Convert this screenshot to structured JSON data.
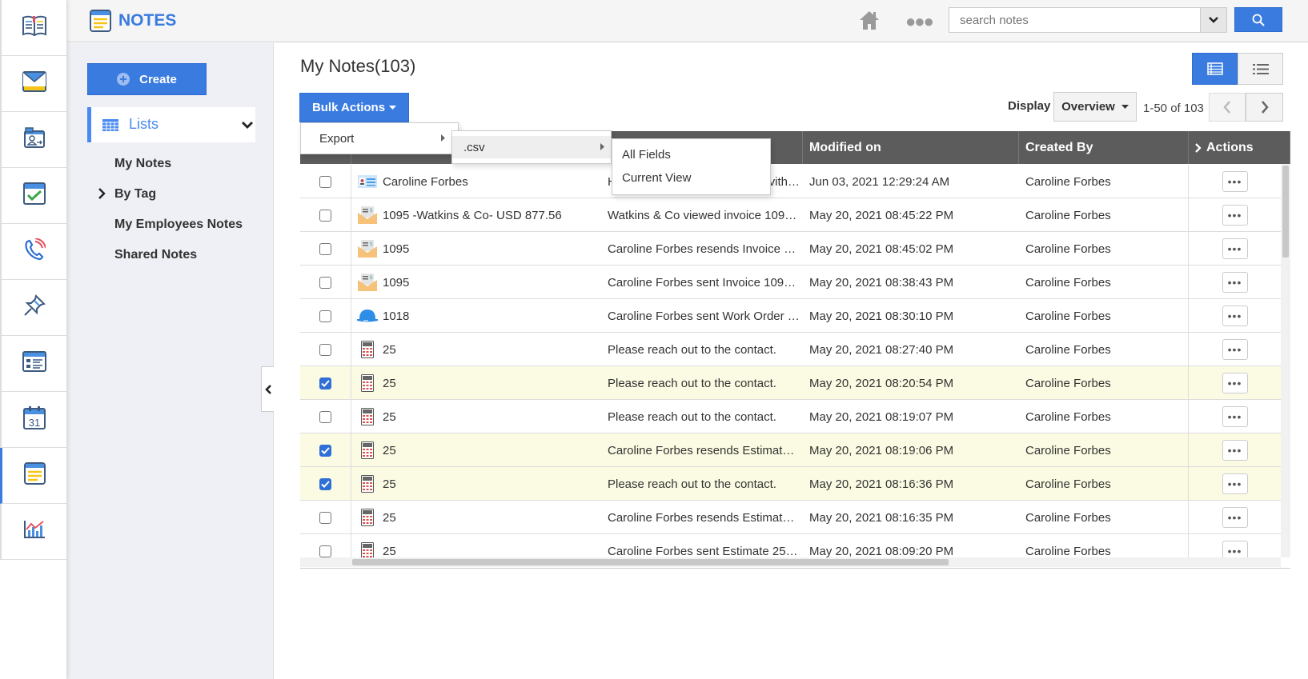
{
  "app": {
    "title": "NOTES",
    "accent": "#3a7be0"
  },
  "nav_icons": [
    "knowledge-base-icon",
    "mail-icon",
    "contacts-folder-icon",
    "tasks-calendar-icon",
    "phone-icon",
    "pin-icon",
    "forms-icon",
    "calendar-icon",
    "notes-icon",
    "reports-icon"
  ],
  "nav_calendar_day": "31",
  "header": {
    "search_placeholder": "search notes"
  },
  "sidebar": {
    "create_label": "Create",
    "lists_label": "Lists",
    "items": [
      {
        "label": "My Notes"
      },
      {
        "label": "By Tag"
      },
      {
        "label": "My Employees Notes"
      },
      {
        "label": "Shared Notes"
      }
    ]
  },
  "main": {
    "title": "My Notes(103)",
    "bulk_actions_label": "Bulk Actions",
    "display_label": "Display",
    "display_value": "Overview",
    "pagination": "1-50 of 103"
  },
  "menus": {
    "export": "Export",
    "csv": ".csv",
    "all_fields": "All Fields",
    "current_view": "Current View"
  },
  "table": {
    "columns": [
      "Modified on",
      "Created By",
      "Actions"
    ],
    "rows": [
      {
        "checked": false,
        "icon": "contact-card-icon",
        "name": "Caroline Forbes",
        "desc_start": "H",
        "desc_end": "vith…",
        "modified": "Jun 03, 2021 12:29:24 AM",
        "created_by": "Caroline Forbes"
      },
      {
        "checked": false,
        "icon": "invoice-envelope-icon",
        "name": "1095 -Watkins & Co- USD 877.56",
        "desc": "Watkins & Co viewed invoice 109…",
        "modified": "May 20, 2021 08:45:22 PM",
        "created_by": "Caroline Forbes"
      },
      {
        "checked": false,
        "icon": "invoice-envelope-icon",
        "name": "1095",
        "desc": "Caroline Forbes resends Invoice …",
        "modified": "May 20, 2021 08:45:02 PM",
        "created_by": "Caroline Forbes"
      },
      {
        "checked": false,
        "icon": "invoice-envelope-icon",
        "name": "1095",
        "desc": "Caroline Forbes sent Invoice 109…",
        "modified": "May 20, 2021 08:38:43 PM",
        "created_by": "Caroline Forbes"
      },
      {
        "checked": false,
        "icon": "work-order-helmet-icon",
        "name": "1018",
        "desc": "Caroline Forbes sent Work Order …",
        "modified": "May 20, 2021 08:30:10 PM",
        "created_by": "Caroline Forbes"
      },
      {
        "checked": false,
        "icon": "calculator-icon",
        "name": "25",
        "desc": "Please reach out to the contact.",
        "modified": "May 20, 2021 08:27:40 PM",
        "created_by": "Caroline Forbes"
      },
      {
        "checked": true,
        "icon": "calculator-icon",
        "name": "25",
        "desc": "Please reach out to the contact.",
        "modified": "May 20, 2021 08:20:54 PM",
        "created_by": "Caroline Forbes"
      },
      {
        "checked": false,
        "icon": "calculator-icon",
        "name": "25",
        "desc": "Please reach out to the contact.",
        "modified": "May 20, 2021 08:19:07 PM",
        "created_by": "Caroline Forbes"
      },
      {
        "checked": true,
        "icon": "calculator-icon",
        "name": "25",
        "desc": "Caroline Forbes resends Estimat…",
        "modified": "May 20, 2021 08:19:06 PM",
        "created_by": "Caroline Forbes"
      },
      {
        "checked": true,
        "icon": "calculator-icon",
        "name": "25",
        "desc": "Please reach out to the contact.",
        "modified": "May 20, 2021 08:16:36 PM",
        "created_by": "Caroline Forbes"
      },
      {
        "checked": false,
        "icon": "calculator-icon",
        "name": "25",
        "desc": "Caroline Forbes resends Estimat…",
        "modified": "May 20, 2021 08:16:35 PM",
        "created_by": "Caroline Forbes"
      },
      {
        "checked": false,
        "icon": "calculator-icon",
        "name": "25",
        "desc": "Caroline Forbes sent Estimate 25…",
        "modified": "May 20, 2021 08:09:20 PM",
        "created_by": "Caroline Forbes"
      }
    ]
  }
}
